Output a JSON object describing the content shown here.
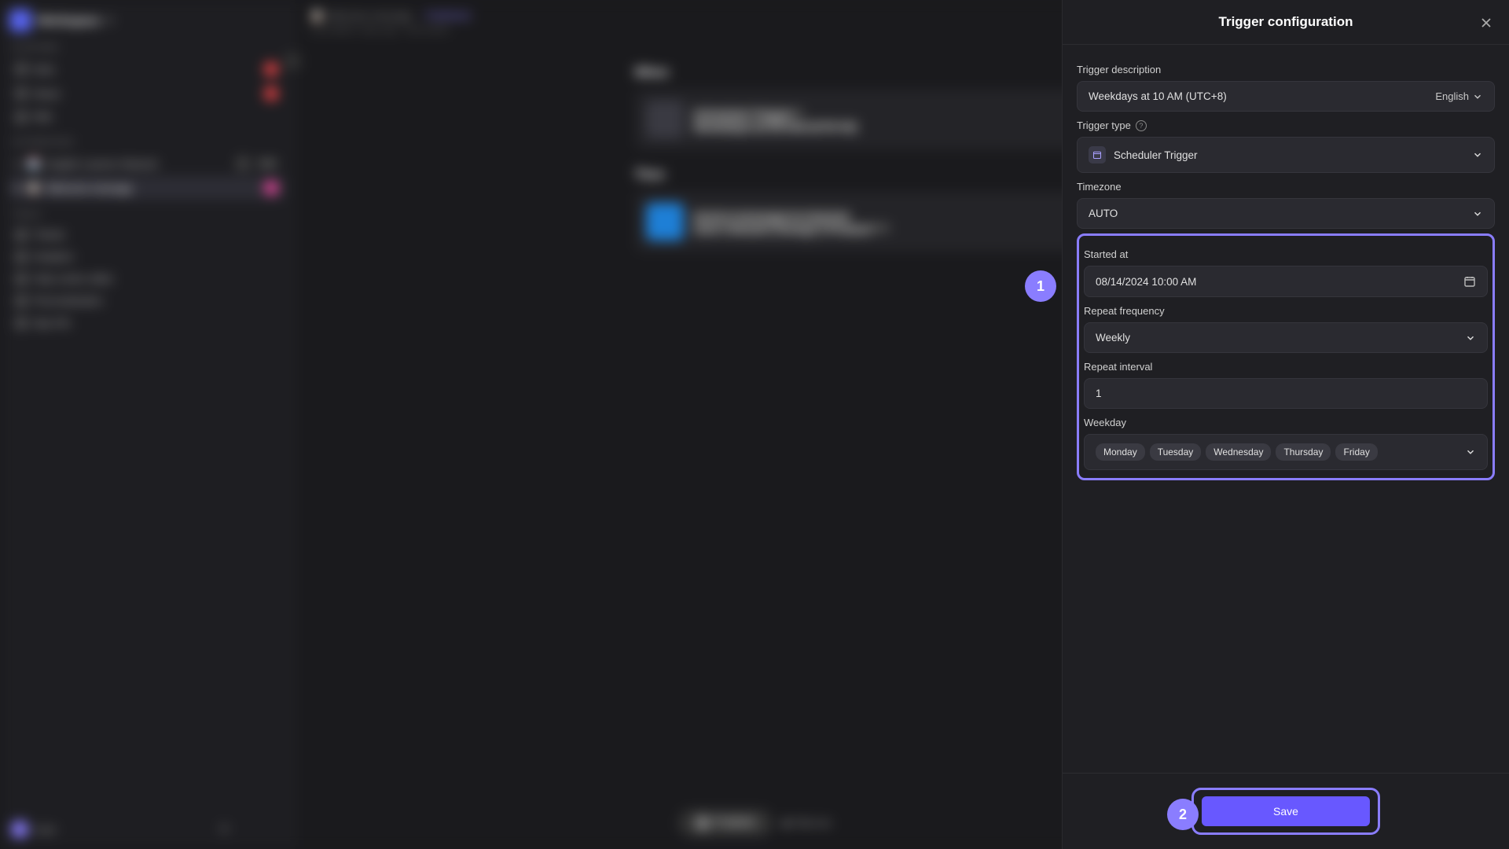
{
  "workspace": {
    "name": "Workspace"
  },
  "sidebar": {
    "platform_label": "PLATFORM",
    "items": [
      {
        "label": "Note"
      },
      {
        "label": "Sheet"
      },
      {
        "label": "Wiki"
      }
    ],
    "automations_label": "AUTOMATIONS",
    "auto_items": [
      {
        "prefix": "🗓️",
        "label": "English Learner Network",
        "badge": "Draft"
      },
      {
        "prefix": "📋",
        "label": "Welcome message"
      }
    ],
    "tools_label": "TOOLS",
    "tools": [
      {
        "label": "Tickets"
      },
      {
        "label": "Analytics"
      },
      {
        "label": "Help center editor"
      },
      {
        "label": "Personalization"
      },
      {
        "label": "App info"
      }
    ],
    "user": "User"
  },
  "main": {
    "breadcrumb": "Welcome message",
    "badge": "Published",
    "meta": "Last edited 2 days ago · Auto-saved",
    "h_when": "When",
    "h_then": "Then",
    "when_t1": "Scheduler Trigger",
    "when_t2": "Weekdays at 10 AM (UTC+8)",
    "then_t1": "Send a message to channel",
    "then_t2": "User | Mozart | Design | Product",
    "btn_save": "Publish",
    "btn_preview": "Test run"
  },
  "panel": {
    "title": "Trigger configuration",
    "desc_label": "Trigger description",
    "desc_value": "Weekdays at 10 AM (UTC+8)",
    "lang": "English",
    "type_label": "Trigger type",
    "type_value": "Scheduler Trigger",
    "tz_label": "Timezone",
    "tz_value": "AUTO",
    "start_label": "Started at",
    "start_value": "08/14/2024 10:00 AM",
    "freq_label": "Repeat frequency",
    "freq_value": "Weekly",
    "interval_label": "Repeat interval",
    "interval_value": "1",
    "weekday_label": "Weekday",
    "weekdays": [
      "Monday",
      "Tuesday",
      "Wednesday",
      "Thursday",
      "Friday"
    ],
    "save": "Save"
  },
  "callouts": {
    "c1": "1",
    "c2": "2"
  }
}
